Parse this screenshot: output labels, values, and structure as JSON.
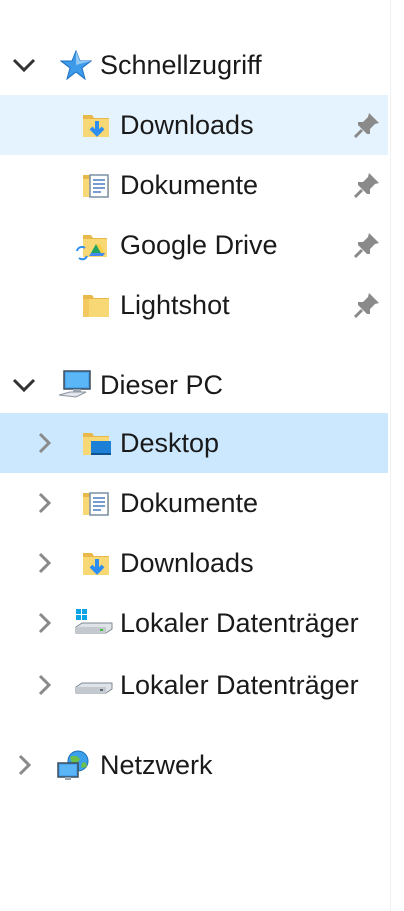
{
  "nav": {
    "quick_access": {
      "label": "Schnellzugriff",
      "icon": "star-icon",
      "items": [
        {
          "label": "Downloads",
          "icon": "downloads-folder-icon",
          "pinned": true
        },
        {
          "label": "Dokumente",
          "icon": "documents-folder-icon",
          "pinned": true
        },
        {
          "label": "Google Drive",
          "icon": "google-drive-folder-icon",
          "pinned": true
        },
        {
          "label": "Lightshot",
          "icon": "folder-icon",
          "pinned": true
        }
      ]
    },
    "this_pc": {
      "label": "Dieser PC",
      "icon": "computer-icon",
      "items": [
        {
          "label": "Desktop",
          "icon": "desktop-folder-icon"
        },
        {
          "label": "Dokumente",
          "icon": "documents-folder-icon"
        },
        {
          "label": "Downloads",
          "icon": "downloads-folder-icon"
        },
        {
          "label": "Lokaler Datenträger",
          "icon": "windows-drive-icon"
        },
        {
          "label": "Lokaler Datenträger",
          "icon": "drive-icon"
        }
      ]
    },
    "network": {
      "label": "Netzwerk",
      "icon": "network-icon"
    }
  },
  "colors": {
    "hover": "#e5f3ff",
    "selected": "#cce8ff",
    "folder": "#f8d775",
    "accent": "#2e8ef0"
  }
}
